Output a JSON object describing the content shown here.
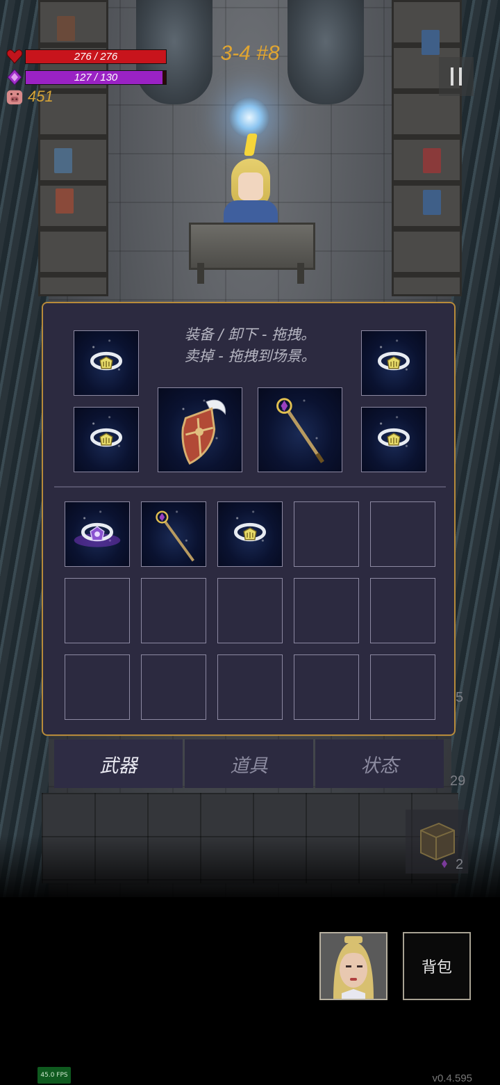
{
  "hud": {
    "hp_text": "276 / 276",
    "hp_fraction": 1.0,
    "mp_text": "127 / 130",
    "mp_fraction": 0.977,
    "gold": "451",
    "level": "3-4 #8",
    "hp_color": "#c8141c",
    "mp_color": "#9a22c4"
  },
  "inventory": {
    "instructions_line1": "装备 / 卸下 - 拖拽。",
    "instructions_line2": "卖掉 - 拖拽到场景。",
    "equipped": {
      "ring_top_left": "ring-yellow-gem-icon",
      "ring_bottom_left": "ring-yellow-gem-icon",
      "armor": "winged-shield-icon",
      "weapon": "staff-icon",
      "ring_top_right": "ring-yellow-gem-icon",
      "ring_bottom_right": "ring-yellow-gem-icon"
    },
    "bag_slots": [
      "ring-purple-gem-icon",
      "staff-icon",
      "ring-yellow-gem-icon",
      "",
      "",
      "",
      "",
      "",
      "",
      "",
      "",
      "",
      "",
      "",
      ""
    ],
    "tabs": [
      {
        "label": "武器",
        "active": true
      },
      {
        "label": "道具",
        "active": false
      },
      {
        "label": "状态",
        "active": false
      }
    ]
  },
  "side": {
    "num_a": "5",
    "num_b": "29",
    "cube_count": "2"
  },
  "bottom": {
    "bag_label": "背包",
    "fps": "45.0 FPS",
    "version": "v0.4.595"
  }
}
